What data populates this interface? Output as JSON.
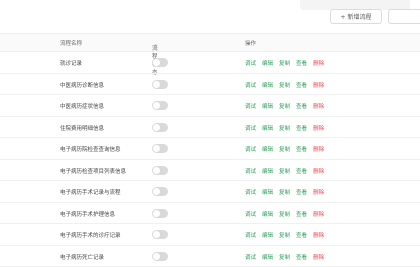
{
  "toolbar": {
    "add_label": "+ 新增流程"
  },
  "table": {
    "headers": {
      "name": "流程名称",
      "status": "流程状态",
      "ops": "操作"
    },
    "rows": [
      {
        "name": "就诊记录",
        "enabled": false
      },
      {
        "name": "中医病历诊断信息",
        "enabled": false
      },
      {
        "name": "中医病历症状信息",
        "enabled": false
      },
      {
        "name": "住院费用明细信息",
        "enabled": false
      },
      {
        "name": "电子病历院检查查询信息",
        "enabled": false
      },
      {
        "name": "电子病历检查项目列表信息",
        "enabled": false
      },
      {
        "name": "电子病历手术记录与流程",
        "enabled": false
      },
      {
        "name": "电子病历手术护理信息",
        "enabled": false
      },
      {
        "name": "电子病历手术的诊疗记录",
        "enabled": false
      },
      {
        "name": "电子病历死亡记录",
        "enabled": false
      }
    ],
    "actions": {
      "debug": "调试",
      "edit": "编辑",
      "copy": "复制",
      "view": "查看",
      "delete": "删除"
    }
  },
  "colors": {
    "action_green": "#2e9e5b",
    "action_red": "#e5484d",
    "toggle_off": "#d9d9d9"
  }
}
